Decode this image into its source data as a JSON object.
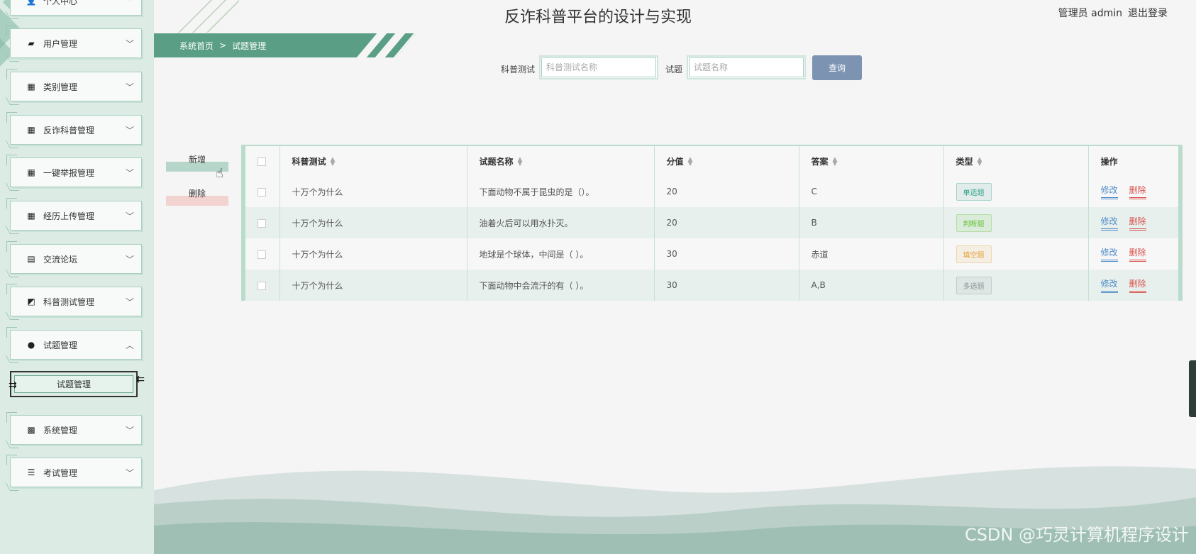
{
  "header": {
    "title": "反诈科普平台的设计与实现",
    "user_label": "管理员 admin",
    "logout_label": "退出登录"
  },
  "sidebar": {
    "items": [
      {
        "label": "个人中心",
        "icon": "user-icon",
        "glyph": "👤"
      },
      {
        "label": "用户管理",
        "icon": "folder-icon",
        "glyph": "▰"
      },
      {
        "label": "类别管理",
        "icon": "grid-icon",
        "glyph": "▦"
      },
      {
        "label": "反诈科普管理",
        "icon": "grid-icon",
        "glyph": "▦"
      },
      {
        "label": "一键举报管理",
        "icon": "grid-icon",
        "glyph": "▦"
      },
      {
        "label": "经历上传管理",
        "icon": "grid-icon",
        "glyph": "▦"
      },
      {
        "label": "交流论坛",
        "icon": "briefcase-icon",
        "glyph": "▤"
      },
      {
        "label": "科普测试管理",
        "icon": "chart-icon",
        "glyph": "◩"
      },
      {
        "label": "试题管理",
        "icon": "bulb-icon",
        "glyph": "●"
      },
      {
        "label": "系统管理",
        "icon": "chat-icon",
        "glyph": "▩"
      },
      {
        "label": "考试管理",
        "icon": "list-icon",
        "glyph": "☰"
      }
    ],
    "sub_item_label": "试题管理"
  },
  "breadcrumb": {
    "home": "系统首页",
    "separator": ">",
    "current": "试题管理"
  },
  "search": {
    "test_label": "科普测试",
    "test_placeholder": "科普测试名称",
    "question_label": "试题",
    "question_placeholder": "试题名称",
    "button_label": "查询"
  },
  "actions": {
    "add_label": "新增",
    "delete_label": "删除"
  },
  "table": {
    "columns": [
      "科普测试",
      "试题名称",
      "分值",
      "答案",
      "类型",
      "操作"
    ],
    "rows": [
      {
        "test": "十万个为什么",
        "question": "下面动物不属于昆虫的是（）。",
        "score": "20",
        "answer": "C",
        "type": "单选题",
        "type_color": "#2e9e8a"
      },
      {
        "test": "十万个为什么",
        "question": "油着火后可以用水扑灭。",
        "score": "20",
        "answer": "B",
        "type": "判断题",
        "type_color": "#67c23a"
      },
      {
        "test": "十万个为什么",
        "question": "地球是个球体，中间是（ ）。",
        "score": "30",
        "answer": "赤道",
        "type": "填空题",
        "type_color": "#e6a23c"
      },
      {
        "test": "十万个为什么",
        "question": "下面动物中会流汗的有（ ）。",
        "score": "30",
        "answer": "A,B",
        "type": "多选题",
        "type_color": "#909399"
      }
    ],
    "edit_label": "修改",
    "delete_label": "删除"
  },
  "watermark": "CSDN @巧灵计算机程序设计"
}
